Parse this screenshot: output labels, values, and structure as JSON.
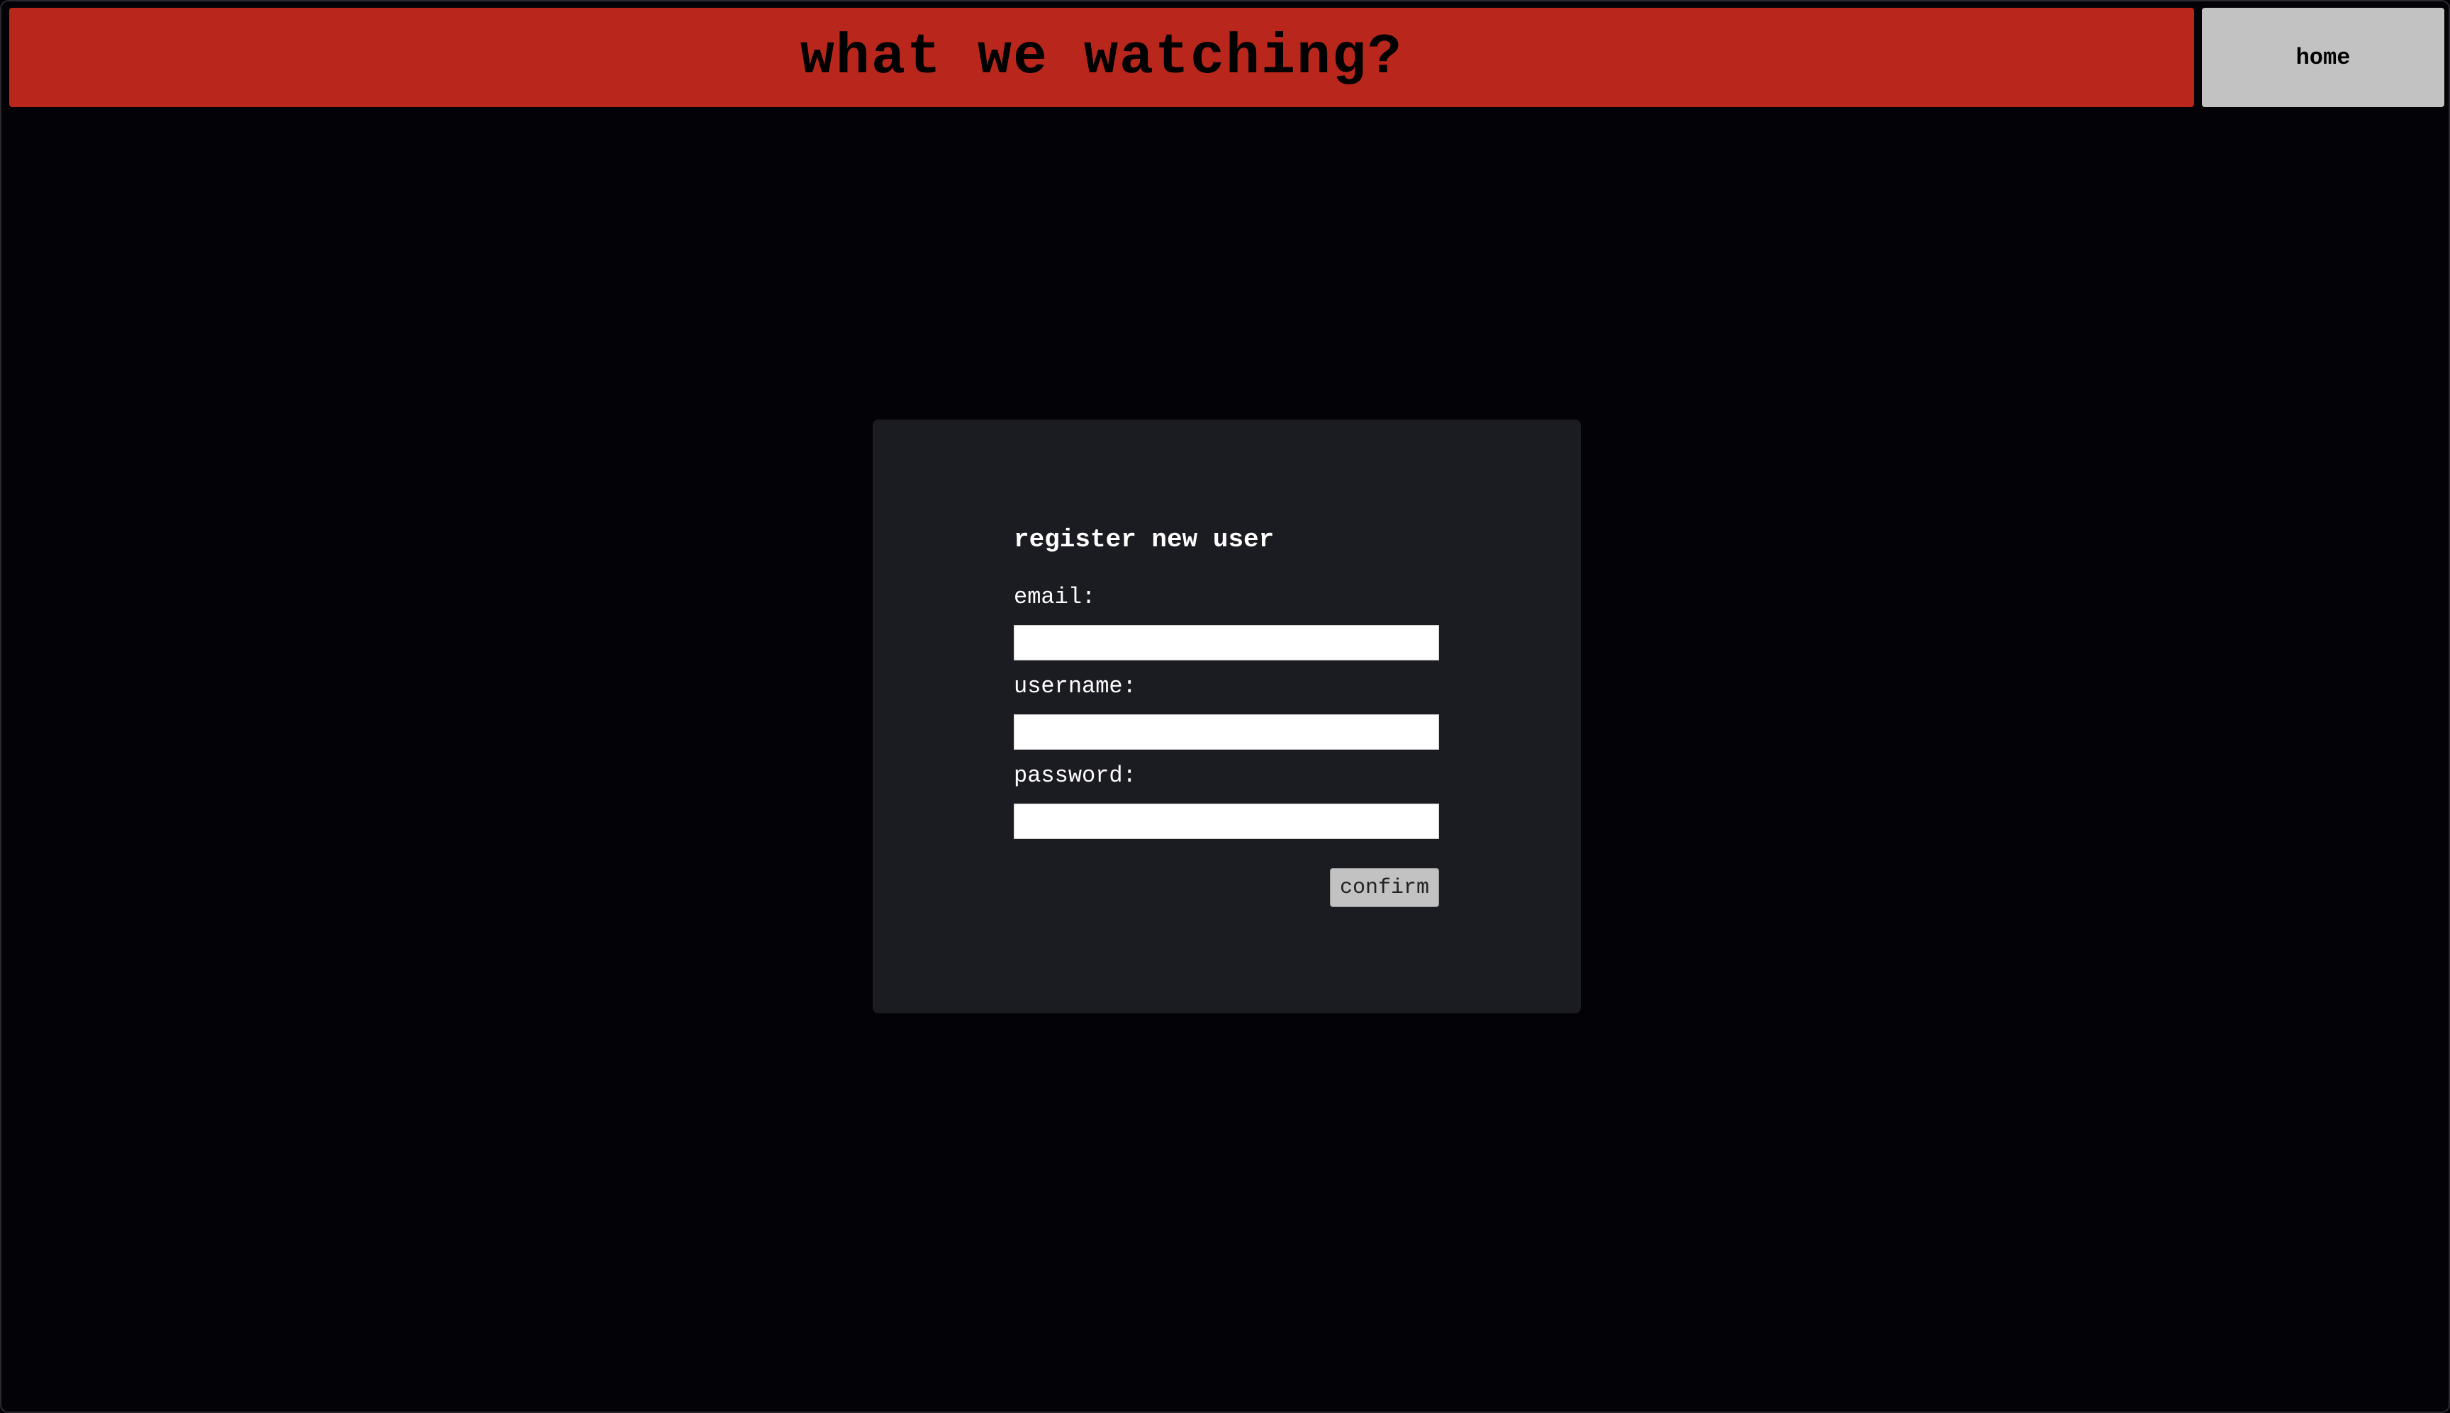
{
  "header": {
    "title": "what we watching?",
    "home_label": "home"
  },
  "register_form": {
    "title": "register new user",
    "email_label": "email:",
    "email_value": "",
    "username_label": "username:",
    "username_value": "",
    "password_label": "password:",
    "password_value": "",
    "confirm_label": "confirm"
  },
  "colors": {
    "background": "#020207",
    "header_bar": "#b8261c",
    "home_button": "#c2c2c2",
    "card": "#1b1b22",
    "text_light": "#ffffff",
    "text_dark": "#000000"
  }
}
